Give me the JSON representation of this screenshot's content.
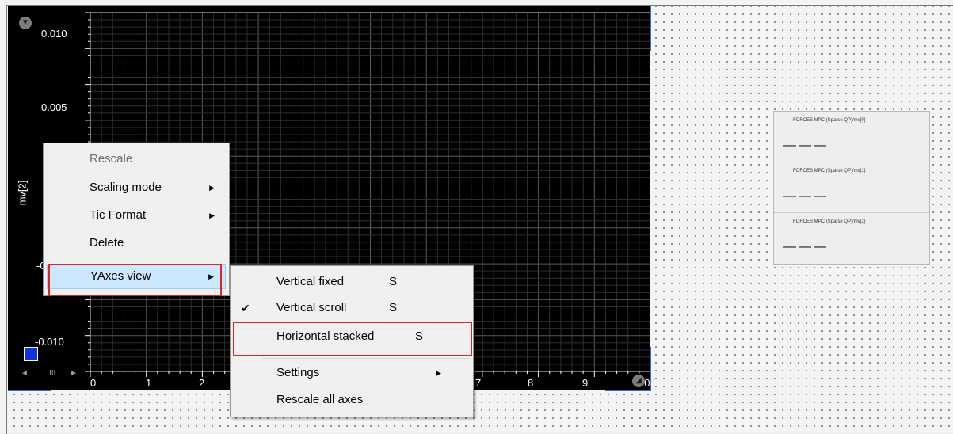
{
  "plot": {
    "ylabel": "mv[2]",
    "y_ticks": [
      "0.010",
      "0.005",
      "-0.010"
    ],
    "hidden_tick_partial": "-0",
    "x_ticks": [
      "0",
      "1",
      "2",
      "7",
      "8",
      "9",
      "10"
    ],
    "swatch_color": "#1133dd",
    "scroll_glyphs": {
      "left": "◄",
      "thumb": "III",
      "right": "►"
    }
  },
  "legend": {
    "items": [
      {
        "label": "FORCES MPC (Sparse QP)/mv[0]",
        "sample": "———"
      },
      {
        "label": "FORCES MPC (Sparse QP)/mv[1]",
        "sample": "———"
      },
      {
        "label": "FORCES MPC (Sparse QP)/mv[2]",
        "sample": "———"
      }
    ]
  },
  "context_menu": {
    "items": [
      {
        "label": "Rescale",
        "disabled": true
      },
      {
        "label": "Scaling mode",
        "submenu": true
      },
      {
        "label": "Tic Format",
        "submenu": true
      },
      {
        "label": "Delete"
      },
      {
        "label": "YAxes view",
        "submenu": true,
        "highlighted": true
      }
    ]
  },
  "submenu": {
    "items": [
      {
        "label": "Vertical fixed",
        "shortcut": "S"
      },
      {
        "label": "Vertical scroll",
        "shortcut": "S",
        "checked": true
      },
      {
        "label": "Horizontal stacked",
        "shortcut": "S",
        "boxed": true
      },
      {
        "label": "Settings",
        "submenu": true
      },
      {
        "label": "Rescale all axes"
      }
    ],
    "check_glyph": "✔",
    "arrow_glyph": "▶"
  },
  "colors": {
    "highlight": "#cce8ff",
    "annotation_red": "#e02424",
    "plot_bg": "#000000"
  }
}
